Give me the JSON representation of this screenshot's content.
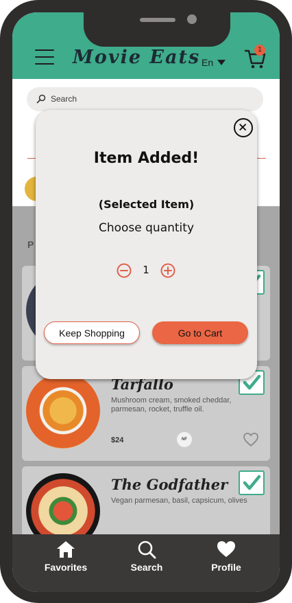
{
  "header": {
    "title": "Movie Eats",
    "language": "En",
    "cart_count": "1"
  },
  "search": {
    "placeholder": "Search"
  },
  "section": {
    "label": "P"
  },
  "menu_items": [
    {
      "name": "Tarfallo",
      "description": "Mushroom cream, smoked cheddar, parmesan, rocket, truffle oil.",
      "price": "$24",
      "badge": "NF"
    },
    {
      "name": "The Godfather",
      "description": "Vegan parmesan, basil, capsicum, olives"
    }
  ],
  "modal": {
    "title": "Item Added!",
    "item_name": "(Selected Item)",
    "prompt": "Choose quantity",
    "quantity": "1",
    "keep_shopping_label": "Keep Shopping",
    "go_to_cart_label": "Go to Cart"
  },
  "bottom_nav": [
    {
      "label": "Favorites",
      "icon": "home-icon"
    },
    {
      "label": "Search",
      "icon": "search-icon"
    },
    {
      "label": "Profile",
      "icon": "heart-icon"
    }
  ],
  "colors": {
    "brand_green": "#3fac8c",
    "accent_orange": "#ea6644",
    "nav_dark": "#3b3838"
  }
}
